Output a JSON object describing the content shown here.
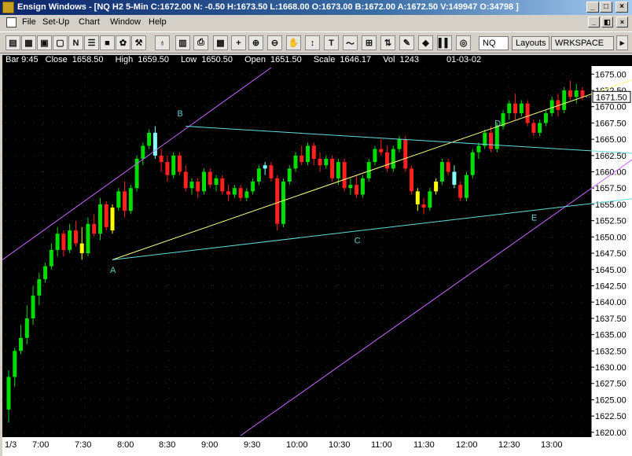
{
  "window": {
    "title": "Ensign Windows - [NQ H2 5-Min C:1672.00 N: -0.50 H:1673.50 L:1668.00 O:1673.00 B:1672.00 A:1672.50 V:149947 O:34798 ]",
    "min_label": "_",
    "max_label": "□",
    "close_label": "×"
  },
  "menu": {
    "items": [
      "File",
      "Set-Up",
      "Chart",
      "Window",
      "Help"
    ]
  },
  "toolbar": {
    "text_tool": "T",
    "symbol_box": "NQ",
    "layouts_label": "Layouts",
    "workspace_label": "WRKSPACE"
  },
  "status": {
    "bar_label": "Bar 9:45",
    "close_label": "Close",
    "close_value": "1658.50",
    "high_label": "High",
    "high_value": "1659.50",
    "low_label": "Low",
    "low_value": "1650.50",
    "open_label": "Open",
    "open_value": "1651.50",
    "scale_label": "Scale",
    "scale_value": "1646.17",
    "vol_label": "Vol",
    "vol_value": "1243",
    "date": "01-03-02"
  },
  "colors": {
    "background": "#000000",
    "up_bar": "#00dd00",
    "down_bar": "#ff2020",
    "highlight_up": "#ffff00",
    "highlight_down": "#88ffff",
    "channel": "#cc66ff",
    "trendline_yellow": "#ffff88",
    "trendline_cyan": "#66dddd",
    "label": "#66cccc",
    "last_price_box": "#ffffff"
  },
  "chart_data": {
    "type": "candlestick",
    "symbol": "NQ H2 5-Min",
    "y_ticks": [
      1675.0,
      1672.5,
      1670.0,
      1667.5,
      1665.0,
      1662.5,
      1660.0,
      1657.5,
      1655.0,
      1652.5,
      1650.0,
      1647.5,
      1645.0,
      1642.5,
      1640.0,
      1637.5,
      1635.0,
      1632.5,
      1630.0,
      1627.5,
      1625.0,
      1622.5,
      1620.0
    ],
    "y_tick_labels": [
      "1675.00",
      "1672.50",
      "1670.00",
      "1667.50",
      "1665.00",
      "1662.50",
      "1660.00",
      "1657.50",
      "1655.00",
      "1652.50",
      "1650.00",
      "1647.50",
      "1645.00",
      "1642.50",
      "1640.00",
      "1637.50",
      "1635.00",
      "1632.50",
      "1630.00",
      "1627.50",
      "1625.00",
      "1622.50",
      "1620.00"
    ],
    "ylim": [
      1619.5,
      1676.0
    ],
    "x_labels": [
      "1/3",
      "7:00",
      "7:30",
      "8:00",
      "8:30",
      "9:00",
      "9:30",
      "10:00",
      "10:30",
      "11:00",
      "11:30",
      "12:00",
      "12:30",
      "13:00"
    ],
    "last_price": "1671.50",
    "pattern_labels": [
      "A",
      "B",
      "C",
      "D",
      "E"
    ],
    "grid": true,
    "candles": [
      [
        1623.5,
        1629.5,
        1621.5,
        1628.5
      ],
      [
        1628.5,
        1633.0,
        1627.0,
        1632.5
      ],
      [
        1632.5,
        1636.5,
        1632.0,
        1634.5
      ],
      [
        1634.5,
        1639.5,
        1633.5,
        1637.5
      ],
      [
        1637.5,
        1642.5,
        1636.5,
        1641.0
      ],
      [
        1641.0,
        1644.5,
        1639.5,
        1643.5
      ],
      [
        1643.5,
        1646.0,
        1643.0,
        1645.5
      ],
      [
        1645.5,
        1649.0,
        1645.0,
        1648.0
      ],
      [
        1648.0,
        1651.5,
        1647.0,
        1650.5
      ],
      [
        1650.5,
        1651.0,
        1647.0,
        1648.0
      ],
      [
        1648.0,
        1652.0,
        1647.5,
        1651.0
      ],
      [
        1651.0,
        1652.5,
        1648.5,
        1649.0
      ],
      [
        1649.0,
        1651.5,
        1646.5,
        1647.5
      ],
      [
        1647.5,
        1653.0,
        1647.0,
        1652.0
      ],
      [
        1652.0,
        1653.5,
        1650.0,
        1650.5
      ],
      [
        1650.5,
        1656.0,
        1649.5,
        1655.0
      ],
      [
        1655.0,
        1655.5,
        1651.0,
        1651.5
      ],
      [
        1651.0,
        1655.0,
        1650.5,
        1654.5
      ],
      [
        1654.5,
        1657.5,
        1654.0,
        1657.0
      ],
      [
        1657.0,
        1658.5,
        1653.0,
        1654.0
      ],
      [
        1654.0,
        1658.0,
        1653.5,
        1657.5
      ],
      [
        1657.5,
        1662.5,
        1657.0,
        1662.0
      ],
      [
        1662.0,
        1664.5,
        1661.0,
        1664.0
      ],
      [
        1664.0,
        1666.5,
        1663.5,
        1666.0
      ],
      [
        1666.0,
        1667.0,
        1662.0,
        1662.5
      ],
      [
        1662.5,
        1663.5,
        1660.0,
        1661.5
      ],
      [
        1661.5,
        1662.5,
        1658.5,
        1659.5
      ],
      [
        1659.5,
        1663.0,
        1659.0,
        1662.5
      ],
      [
        1662.5,
        1663.0,
        1659.5,
        1660.0
      ],
      [
        1660.0,
        1661.0,
        1657.0,
        1657.5
      ],
      [
        1657.5,
        1659.0,
        1656.5,
        1658.5
      ],
      [
        1658.5,
        1659.0,
        1656.0,
        1657.0
      ],
      [
        1657.0,
        1660.5,
        1656.5,
        1660.0
      ],
      [
        1660.0,
        1660.5,
        1657.5,
        1658.0
      ],
      [
        1658.0,
        1659.5,
        1657.0,
        1659.0
      ],
      [
        1659.0,
        1659.5,
        1656.5,
        1657.0
      ],
      [
        1657.0,
        1658.0,
        1655.5,
        1656.5
      ],
      [
        1656.5,
        1658.0,
        1656.0,
        1657.5
      ],
      [
        1657.5,
        1658.0,
        1655.5,
        1656.0
      ],
      [
        1656.0,
        1657.5,
        1655.5,
        1657.0
      ],
      [
        1657.0,
        1659.0,
        1656.5,
        1658.5
      ],
      [
        1658.5,
        1661.0,
        1658.0,
        1660.5
      ],
      [
        1660.5,
        1661.5,
        1659.5,
        1661.0
      ],
      [
        1661.0,
        1661.5,
        1658.5,
        1659.0
      ],
      [
        1659.0,
        1659.5,
        1651.0,
        1652.0
      ],
      [
        1652.0,
        1659.0,
        1651.5,
        1658.5
      ],
      [
        1658.5,
        1661.0,
        1658.0,
        1660.5
      ],
      [
        1660.5,
        1663.0,
        1660.0,
        1662.5
      ],
      [
        1662.5,
        1664.0,
        1661.0,
        1661.5
      ],
      [
        1661.5,
        1664.5,
        1661.0,
        1664.0
      ],
      [
        1664.0,
        1664.5,
        1661.0,
        1662.0
      ],
      [
        1662.0,
        1663.0,
        1660.0,
        1661.0
      ],
      [
        1661.0,
        1662.5,
        1660.5,
        1662.0
      ],
      [
        1662.0,
        1662.5,
        1658.5,
        1659.0
      ],
      [
        1659.0,
        1662.0,
        1658.0,
        1661.5
      ],
      [
        1661.5,
        1662.0,
        1657.0,
        1657.5
      ],
      [
        1657.5,
        1659.0,
        1656.5,
        1658.0
      ],
      [
        1658.0,
        1659.5,
        1656.0,
        1656.5
      ],
      [
        1656.5,
        1659.5,
        1656.0,
        1659.0
      ],
      [
        1659.0,
        1662.0,
        1658.5,
        1661.5
      ],
      [
        1661.5,
        1664.0,
        1661.0,
        1663.5
      ],
      [
        1663.5,
        1665.0,
        1662.5,
        1663.0
      ],
      [
        1663.0,
        1664.0,
        1660.0,
        1660.5
      ],
      [
        1660.5,
        1664.0,
        1660.0,
        1663.5
      ],
      [
        1663.5,
        1665.5,
        1663.0,
        1665.0
      ],
      [
        1665.0,
        1665.5,
        1660.0,
        1660.5
      ],
      [
        1660.5,
        1661.0,
        1656.5,
        1657.0
      ],
      [
        1657.0,
        1657.5,
        1654.0,
        1655.0
      ],
      [
        1655.0,
        1656.0,
        1653.5,
        1654.5
      ],
      [
        1654.5,
        1657.5,
        1654.0,
        1657.0
      ],
      [
        1657.0,
        1659.0,
        1656.5,
        1658.5
      ],
      [
        1658.5,
        1662.0,
        1658.0,
        1661.5
      ],
      [
        1661.5,
        1662.0,
        1659.5,
        1660.0
      ],
      [
        1660.0,
        1661.0,
        1657.5,
        1658.0
      ],
      [
        1658.0,
        1658.5,
        1655.5,
        1656.0
      ],
      [
        1656.0,
        1660.0,
        1655.5,
        1659.5
      ],
      [
        1659.5,
        1663.5,
        1659.0,
        1663.0
      ],
      [
        1663.0,
        1664.5,
        1662.0,
        1664.0
      ],
      [
        1664.0,
        1666.5,
        1663.5,
        1666.0
      ],
      [
        1666.0,
        1667.0,
        1663.0,
        1663.5
      ],
      [
        1663.5,
        1667.5,
        1663.0,
        1667.0
      ],
      [
        1667.0,
        1669.5,
        1666.5,
        1669.0
      ],
      [
        1669.0,
        1671.0,
        1668.0,
        1670.5
      ],
      [
        1670.5,
        1672.0,
        1668.0,
        1669.0
      ],
      [
        1669.0,
        1671.0,
        1668.5,
        1670.5
      ],
      [
        1670.5,
        1671.0,
        1667.0,
        1667.5
      ],
      [
        1667.5,
        1668.0,
        1665.5,
        1666.0
      ],
      [
        1666.0,
        1668.0,
        1665.5,
        1667.5
      ],
      [
        1667.5,
        1669.5,
        1667.0,
        1669.0
      ],
      [
        1669.0,
        1671.5,
        1668.5,
        1671.0
      ],
      [
        1671.0,
        1672.0,
        1668.5,
        1669.5
      ],
      [
        1669.5,
        1673.0,
        1669.0,
        1672.5
      ],
      [
        1672.5,
        1674.0,
        1671.0,
        1671.5
      ],
      [
        1671.5,
        1673.5,
        1670.5,
        1672.5
      ],
      [
        1672.5,
        1673.0,
        1671.0,
        1671.5
      ]
    ]
  }
}
